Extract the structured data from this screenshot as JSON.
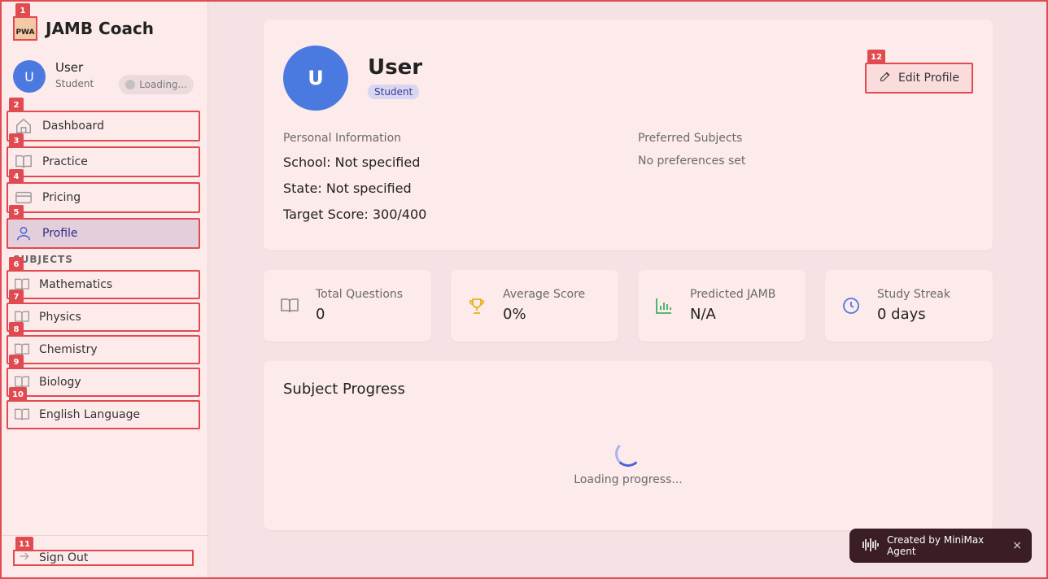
{
  "brand": {
    "logo_text": "PWA",
    "title": "JAMB Coach"
  },
  "user": {
    "initial": "U",
    "name": "User",
    "role": "Student",
    "loading_label": "Loading..."
  },
  "nav": [
    {
      "label": "Dashboard",
      "icon": "home-icon"
    },
    {
      "label": "Practice",
      "icon": "book-open-icon"
    },
    {
      "label": "Pricing",
      "icon": "credit-card-icon"
    },
    {
      "label": "Profile",
      "icon": "user-icon",
      "active": true
    }
  ],
  "subjects_heading": "SUBJECTS",
  "subjects": [
    {
      "label": "Mathematics",
      "icon": "book-open-icon"
    },
    {
      "label": "Physics",
      "icon": "book-open-icon"
    },
    {
      "label": "Chemistry",
      "icon": "book-open-icon"
    },
    {
      "label": "Biology",
      "icon": "book-open-icon"
    },
    {
      "label": "English Language",
      "icon": "book-open-icon"
    }
  ],
  "sign_out": "Sign Out",
  "tags": [
    "1",
    "2",
    "3",
    "4",
    "5",
    "6",
    "7",
    "8",
    "9",
    "10",
    "11",
    "12"
  ],
  "profile": {
    "initial": "U",
    "name": "User",
    "badge": "Student",
    "edit_label": "Edit Profile",
    "personal_heading": "Personal Information",
    "school": "School: Not specified",
    "state": "State: Not specified",
    "target": "Target Score: 300/400",
    "preferred_heading": "Preferred Subjects",
    "preferred_value": "No preferences set"
  },
  "stats": [
    {
      "label": "Total Questions",
      "value": "0",
      "icon": "book-open-icon",
      "color": "#8a8a8a"
    },
    {
      "label": "Average Score",
      "value": "0%",
      "icon": "trophy-icon",
      "color": "#e8b020"
    },
    {
      "label": "Predicted JAMB",
      "value": "N/A",
      "icon": "bar-chart-icon",
      "color": "#3cb060"
    },
    {
      "label": "Study Streak",
      "value": "0 days",
      "icon": "clock-icon",
      "color": "#4a7ae0"
    }
  ],
  "progress": {
    "title": "Subject Progress",
    "loading_text": "Loading progress..."
  },
  "toast": {
    "text": "Created by MiniMax Agent",
    "close": "×"
  },
  "colors": {
    "accent": "#e04a50",
    "avatar": "#4a7ae0",
    "active_nav": "#e3cfdb"
  }
}
